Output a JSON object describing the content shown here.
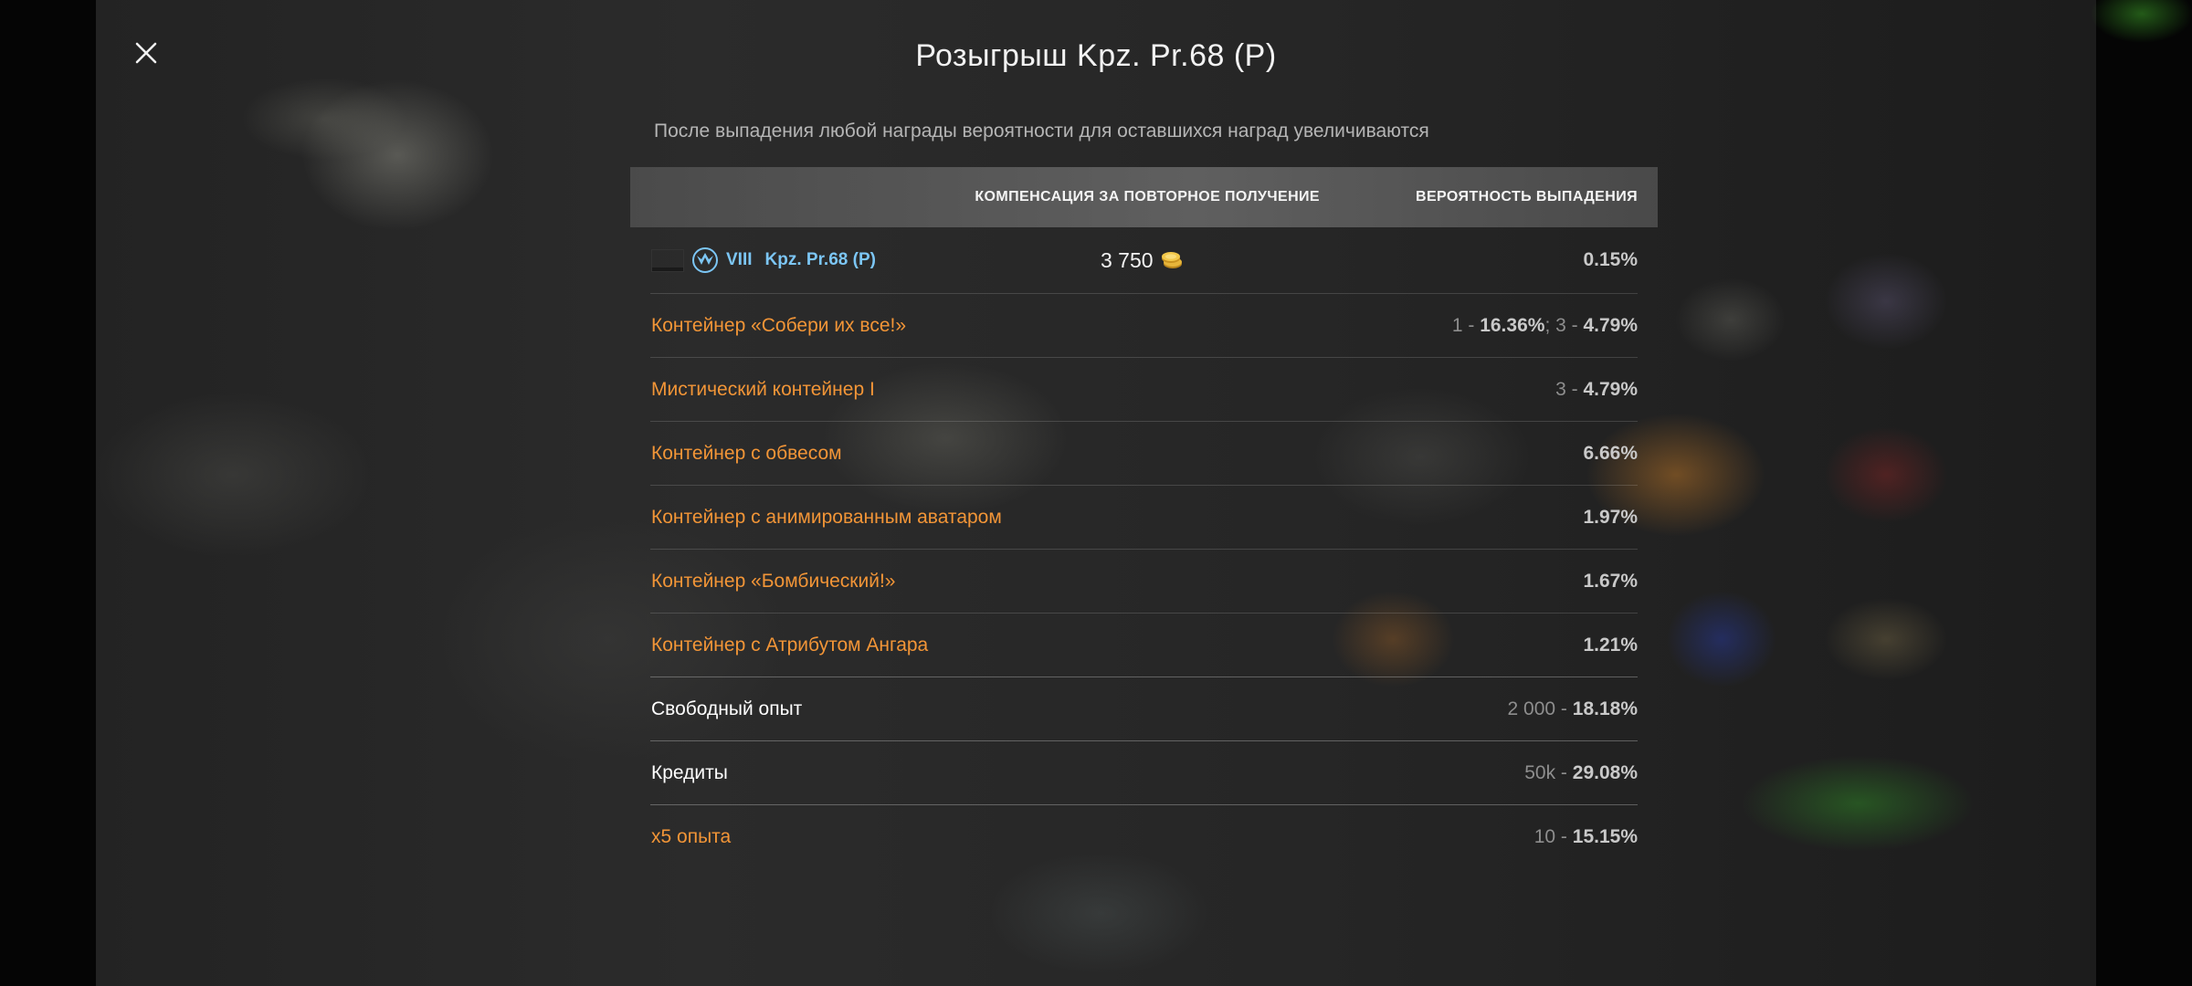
{
  "dialog": {
    "title": "Розыгрыш Kpz. Pr.68 (P)",
    "subtitle": "После выпадения любой награды вероятности для оставшихся наград увеличиваются",
    "close_icon": "close-icon"
  },
  "table": {
    "headers": {
      "compensation": "КОМПЕНСАЦИЯ ЗА ПОВТОРНОЕ ПОЛУЧЕНИЕ",
      "probability": "ВЕРОЯТНОСТЬ ВЫПАДЕНИЯ"
    },
    "tank": {
      "tier": "VIII",
      "name": "Kpz. Pr.68 (P)",
      "compensation": "3 750",
      "compensation_icon": "gold-icon",
      "nation_icon": "germany-flag-icon",
      "class_icon": "tank-class-icon",
      "probability": "0.15%"
    },
    "rows": [
      {
        "name": "Контейнер «Собери их все!»",
        "color": "#f29537",
        "parts": [
          {
            "prefix": "1 - ",
            "value": "16.36%"
          },
          {
            "prefix": "; 3 - ",
            "value": "4.79%"
          }
        ]
      },
      {
        "name": "Мистический контейнер I",
        "color": "#f29537",
        "parts": [
          {
            "prefix": "3 - ",
            "value": "4.79%"
          }
        ]
      },
      {
        "name": "Контейнер с обвесом",
        "color": "#f29537",
        "parts": [
          {
            "prefix": "",
            "value": "6.66%"
          }
        ]
      },
      {
        "name": "Контейнер с анимированным аватаром",
        "color": "#f29537",
        "parts": [
          {
            "prefix": "",
            "value": "1.97%"
          }
        ]
      },
      {
        "name": "Контейнер «Бомбический!»",
        "color": "#f29537",
        "parts": [
          {
            "prefix": "",
            "value": "1.67%"
          }
        ]
      },
      {
        "name": "Контейнер с Атрибутом Ангара",
        "color": "#f29537",
        "parts": [
          {
            "prefix": "",
            "value": "1.21%"
          }
        ]
      },
      {
        "name": "Свободный опыт",
        "color": "#ffffff",
        "parts": [
          {
            "prefix": "2 000 - ",
            "value": "18.18%"
          }
        ]
      },
      {
        "name": "Кредиты",
        "color": "#ffffff",
        "parts": [
          {
            "prefix": "50k - ",
            "value": "29.08%"
          }
        ]
      },
      {
        "name": "x5 опыта",
        "color": "#f29537",
        "parts": [
          {
            "prefix": "10 - ",
            "value": "15.15%"
          }
        ]
      }
    ]
  },
  "colors": {
    "accent_orange": "#f29537",
    "tank_blue": "#7cc6f5",
    "probability_muted": "#8e8e8e",
    "probability_bold": "#c9c9c9"
  }
}
